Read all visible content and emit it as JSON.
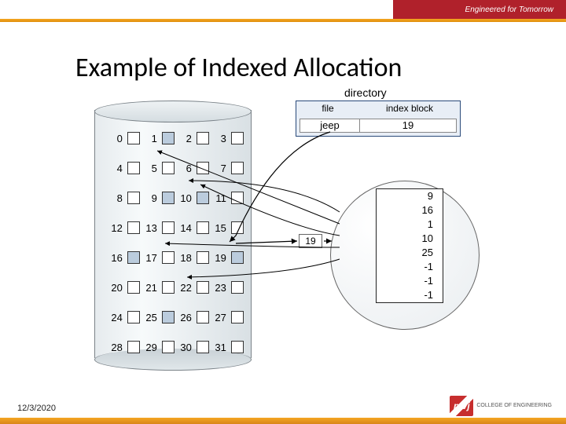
{
  "header": {
    "tagline": "Engineered for Tomorrow"
  },
  "title": "Example of Indexed Allocation",
  "footer": {
    "date": "12/3/2020",
    "logo_main": "mvj",
    "logo_sub": "COLLEGE OF\nENGINEERING"
  },
  "directory": {
    "label": "directory",
    "col_file": "file",
    "col_index": "index block",
    "entry_file": "jeep",
    "entry_index": "19"
  },
  "index_box_label": "19",
  "index_entries": [
    "9",
    "16",
    "1",
    "10",
    "25",
    "-1",
    "-1",
    "-1"
  ],
  "blocks": {
    "rows": [
      [
        "0",
        "1",
        "2",
        "3"
      ],
      [
        "4",
        "5",
        "6",
        "7"
      ],
      [
        "8",
        "9",
        "10",
        "11"
      ],
      [
        "12",
        "13",
        "14",
        "15"
      ],
      [
        "16",
        "17",
        "18",
        "19"
      ],
      [
        "20",
        "21",
        "22",
        "23"
      ],
      [
        "24",
        "25",
        "26",
        "27"
      ],
      [
        "28",
        "29",
        "30",
        "31"
      ]
    ],
    "used": [
      1,
      9,
      10,
      16,
      19,
      25
    ]
  },
  "chart_data": {
    "type": "diagram",
    "title": "Example of Indexed Allocation",
    "file": "jeep",
    "index_block": 19,
    "index_block_contents": [
      9,
      16,
      1,
      10,
      25,
      -1,
      -1,
      -1
    ],
    "disk_block_count": 32,
    "allocated_blocks": [
      1,
      9,
      10,
      16,
      19,
      25
    ]
  }
}
